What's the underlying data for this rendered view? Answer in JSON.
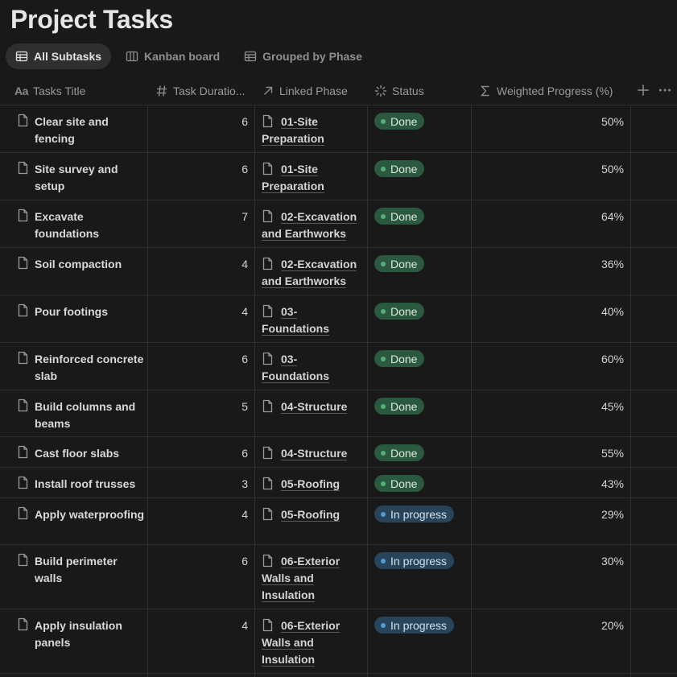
{
  "page": {
    "title": "Project Tasks"
  },
  "tabs": [
    {
      "label": "All Subtasks",
      "icon": "table-icon",
      "active": true
    },
    {
      "label": "Kanban board",
      "icon": "board-icon",
      "active": false
    },
    {
      "label": "Grouped by Phase",
      "icon": "table-icon",
      "active": false
    }
  ],
  "columns": {
    "title": {
      "label": "Tasks Title",
      "icon": "text-type-icon",
      "icon_text": "Aa"
    },
    "duration": {
      "label": "Task Duratio...",
      "icon": "number-icon"
    },
    "phase": {
      "label": "Linked Phase",
      "icon": "relation-arrow-icon"
    },
    "status": {
      "label": "Status",
      "icon": "status-spinner-icon"
    },
    "progress": {
      "label": "Weighted Progress (%)",
      "icon": "sigma-icon"
    }
  },
  "actions": {
    "add_column": "add-column-icon",
    "more": "more-icon"
  },
  "rows": [
    {
      "title": "Clear site and fencing",
      "duration": "6",
      "phase": "01-Site Preparation",
      "status": "Done",
      "progress": "50%"
    },
    {
      "title": "Site survey and setup",
      "duration": "6",
      "phase": "01-Site Preparation",
      "status": "Done",
      "progress": "50%"
    },
    {
      "title": "Excavate foundations",
      "duration": "7",
      "phase": "02-Excavation and Earthworks",
      "status": "Done",
      "progress": "64%"
    },
    {
      "title": "Soil compaction",
      "duration": "4",
      "phase": "02-Excavation and Earthworks",
      "status": "Done",
      "progress": "36%"
    },
    {
      "title": "Pour footings",
      "duration": "4",
      "phase": "03-Foundations",
      "status": "Done",
      "progress": "40%"
    },
    {
      "title": "Reinforced concrete slab",
      "duration": "6",
      "phase": "03-Foundations",
      "status": "Done",
      "progress": "60%"
    },
    {
      "title": "Build columns and beams",
      "duration": "5",
      "phase": "04-Structure",
      "status": "Done",
      "progress": "45%"
    },
    {
      "title": "Cast floor slabs",
      "duration": "6",
      "phase": "04-Structure",
      "status": "Done",
      "progress": "55%"
    },
    {
      "title": "Install roof trusses",
      "duration": "3",
      "phase": "05-Roofing",
      "status": "Done",
      "progress": "43%"
    },
    {
      "title": "Apply waterproofing",
      "duration": "4",
      "phase": "05-Roofing",
      "status": "In progress",
      "progress": "29%"
    },
    {
      "title": "Build perimeter walls",
      "duration": "6",
      "phase": "06-Exterior Walls and Insulation",
      "status": "In progress",
      "progress": "30%"
    },
    {
      "title": "Apply insulation panels",
      "duration": "4",
      "phase": "06-Exterior Walls and Insulation",
      "status": "In progress",
      "progress": "20%"
    }
  ],
  "colors": {
    "background": "#191919",
    "done_badge": "#2b5940",
    "in_progress_badge": "#28445a"
  }
}
